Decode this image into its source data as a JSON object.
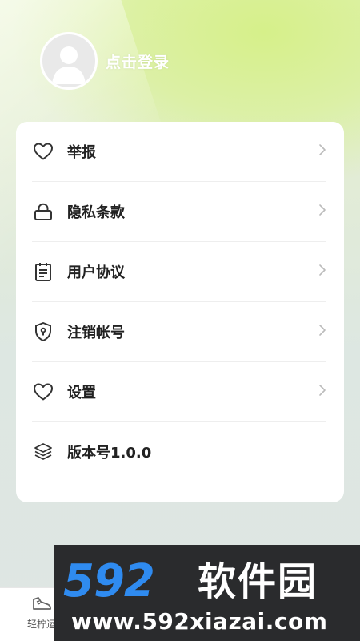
{
  "header": {
    "login_text": "点击登录"
  },
  "menu": {
    "items": [
      {
        "label": "举报",
        "icon": "heart-icon",
        "has_arrow": true
      },
      {
        "label": "隐私条款",
        "icon": "lock-icon",
        "has_arrow": true
      },
      {
        "label": "用户协议",
        "icon": "clipboard-icon",
        "has_arrow": true
      },
      {
        "label": "注销帐号",
        "icon": "shield-keyhole-icon",
        "has_arrow": true
      },
      {
        "label": "设置",
        "icon": "heart-icon",
        "has_arrow": true
      },
      {
        "label": "版本号1.0.0",
        "icon": "layers-icon",
        "has_arrow": false
      }
    ]
  },
  "tabbar": {
    "items": [
      {
        "label": "轻柠运",
        "icon": "sneaker-icon"
      }
    ]
  },
  "watermark": {
    "logo": "592",
    "brand": "软件园",
    "url": "www.592xiazai.com"
  },
  "colors": {
    "card_bg": "#ffffff",
    "text": "#222222",
    "accent_green": "#d6f08a",
    "watermark_blue": "#2f8bf0"
  }
}
